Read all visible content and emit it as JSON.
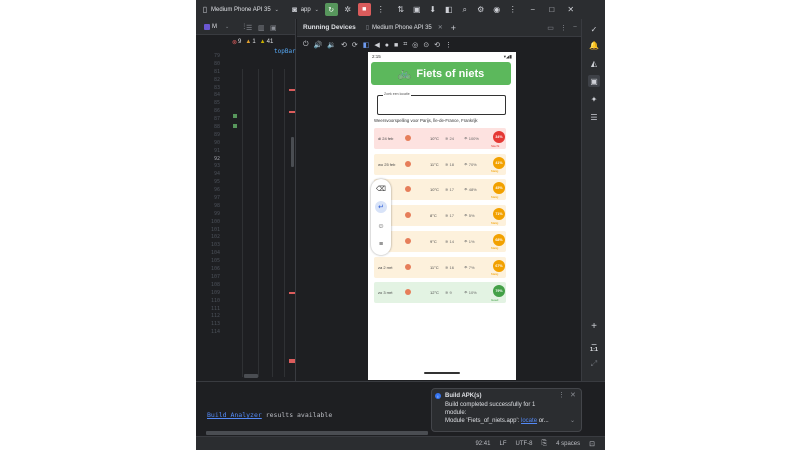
{
  "titlebar": {
    "device_label": "Medium Phone API 35",
    "run_config": "app"
  },
  "editor": {
    "tab_label": "M",
    "errors": "9",
    "warnings": "1",
    "weak_warnings": "41",
    "code_snippet": "topBar",
    "line_numbers": [
      "79",
      "80",
      "81",
      "82",
      "83",
      "84",
      "85",
      "86",
      "87",
      "88",
      "89",
      "90",
      "91",
      "92",
      "93",
      "94",
      "95",
      "96",
      "97",
      "98",
      "99",
      "100",
      "101",
      "102",
      "103",
      "104",
      "105",
      "106",
      "107",
      "108",
      "109",
      "110",
      "111",
      "112",
      "113",
      "114"
    ],
    "current_line": "92"
  },
  "devices": {
    "panel_title": "Running Devices",
    "device_tab": "Medium Phone API 35"
  },
  "phone": {
    "time": "2:15",
    "app_title": "Fiets of niets",
    "search_label": "Zoek een locatie",
    "forecast_title": "Weersvoorspelling voor Parijs, Île-de-France, Frankrijk",
    "days": [
      {
        "day": "di 24 feb",
        "temp": "10°C",
        "wind": "24",
        "rain": "100%",
        "score": "34%",
        "verdict": "Slecht",
        "score_color": "#e53935",
        "bg": "#fde2e0"
      },
      {
        "day": "wo 25 feb",
        "temp": "11°C",
        "wind": "18",
        "rain": "70%",
        "score": "41%",
        "verdict": "Matig",
        "score_color": "#f2a100",
        "bg": "#fdf1dc"
      },
      {
        "day": "",
        "temp": "10°C",
        "wind": "17",
        "rain": "48%",
        "score": "45%",
        "verdict": "Matig",
        "score_color": "#f2a100",
        "bg": "#fdf1dc"
      },
      {
        "day": "",
        "temp": "8°C",
        "wind": "17",
        "rain": "5%",
        "score": "71%",
        "verdict": "Matig",
        "score_color": "#f2a100",
        "bg": "#fdf1dc"
      },
      {
        "day": "",
        "temp": "9°C",
        "wind": "14",
        "rain": "1%",
        "score": "68%",
        "verdict": "Matig",
        "score_color": "#f2a100",
        "bg": "#fdf1dc"
      },
      {
        "day": "za 2 mrt",
        "temp": "11°C",
        "wind": "16",
        "rain": "7%",
        "score": "67%",
        "verdict": "Matig",
        "score_color": "#f2a100",
        "bg": "#fdf1dc"
      },
      {
        "day": "zo 3 mrt",
        "temp": "12°C",
        "wind": "9",
        "rain": "10%",
        "score": "79%",
        "verdict": "Goed",
        "score_color": "#43a047",
        "bg": "#e3f3e3"
      }
    ]
  },
  "right_strip": {
    "zoom_ratio": "1:1"
  },
  "build": {
    "link_text": "Build Analyzer",
    "message_suffix": " results available"
  },
  "notification": {
    "title": "Build APK(s)",
    "line1": "Build completed successfully for 1",
    "line2": "module:",
    "line3_prefix": "Module 'Fiets_of_niets.app': ",
    "line3_link": "locate",
    "line3_suffix": " or..."
  },
  "statusline": {
    "position": "92:41",
    "line_sep": "LF",
    "encoding": "UTF-8",
    "indent": "4 spaces"
  }
}
